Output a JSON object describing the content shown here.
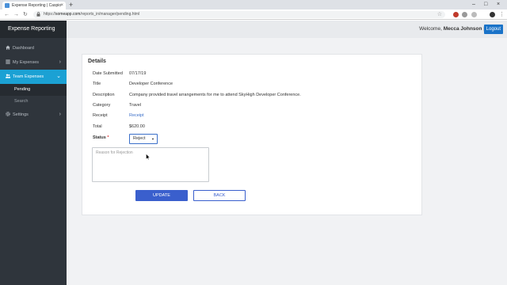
{
  "browser": {
    "tab_title": "Expense Reporting | Caspio",
    "tab_close": "×",
    "new_tab": "+",
    "url_prefix": "https://",
    "url_domain": "someapp.com",
    "url_path": "/reports_in/manager/pending.html",
    "window_controls": [
      "–",
      "□",
      "×"
    ],
    "icons": [
      "back-arrow-icon",
      "forward-arrow-icon",
      "reload-icon",
      "lock-icon",
      "star-icon",
      "extension-icon",
      "profile-avatar-icon",
      "menu-dots-icon"
    ]
  },
  "app": {
    "brand": "Expense Reporting",
    "sidebar": {
      "items": [
        {
          "label": "Dashboard",
          "icon": "home-icon",
          "active": false,
          "chevron": ""
        },
        {
          "label": "My Expenses",
          "icon": "list-icon",
          "active": false,
          "chevron": "›"
        },
        {
          "label": "Team Expenses",
          "icon": "users-icon",
          "active": true,
          "chevron": "⌄"
        },
        {
          "label": "Settings",
          "icon": "gear-icon",
          "active": false,
          "chevron": "›"
        }
      ],
      "sub_items": [
        {
          "label": "Pending",
          "current": true
        },
        {
          "label": "Search",
          "current": false
        }
      ]
    },
    "topbar": {
      "welcome_prefix": "Welcome",
      "user_name": "Mecca Johnson",
      "separator": "|",
      "logout_label": "Logout"
    },
    "details": {
      "heading": "Details",
      "fields": [
        {
          "label": "Date Submitted",
          "value": "07/17/19"
        },
        {
          "label": "Title",
          "value": "Developer Conference"
        },
        {
          "label": "Description",
          "value": "Company provided travel arrangements for me to attend SkyHigh Developer Conference."
        },
        {
          "label": "Category",
          "value": "Travel"
        },
        {
          "label": "Receipt",
          "value": "Receipt"
        },
        {
          "label": "Total",
          "value": "$620.00"
        }
      ],
      "status_label": "Status",
      "required_mark": "*",
      "status_value": "Reject",
      "status_arrow": "▼",
      "rejection_placeholder": "Reason for Rejection",
      "update_label": "UPDATE",
      "back_label": "BACK"
    },
    "colors": {
      "sidebar_bg": "#2f353c",
      "active_nav": "#1ba1d4",
      "primary_button": "#3a5fcd",
      "logout_button": "#1a73c8",
      "link": "#3b6fc9"
    }
  }
}
